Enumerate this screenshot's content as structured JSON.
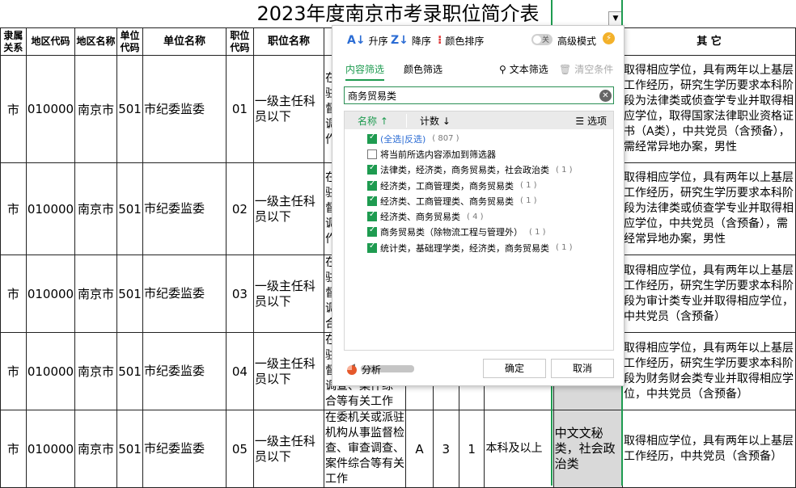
{
  "sheet": {
    "title": "2023年度南京市考录职位简介表",
    "headers": [
      "隶属关系",
      "地区代码",
      "地区名称",
      "单位代码",
      "单位名称",
      "职位代码",
      "职位名称",
      "",
      "",
      "",
      "",
      "",
      "",
      "其  它"
    ],
    "rows": [
      {
        "rel": "市",
        "area_code": "010000",
        "area": "南京市",
        "unit_code": "501",
        "unit": "市纪委监委",
        "pos_code": "01",
        "pos": "一级主任科员以下",
        "desc": "在\n驻\n督\n调\n作",
        "exam": "",
        "n1": "",
        "n2": "",
        "edu": "",
        "major": "",
        "other": "取得相应学位，具有两年以上基层工作经历，研究生学历要求本科阶段为法律类或侦查学专业并取得相应学位，取得国家法律职业资格证书（A类），中共党员（含预备），需经常异地办案，男性"
      },
      {
        "rel": "市",
        "area_code": "010000",
        "area": "南京市",
        "unit_code": "501",
        "unit": "市纪委监委",
        "pos_code": "02",
        "pos": "一级主任科员以下",
        "desc": "在\n驻\n督\n调\n作",
        "exam": "",
        "n1": "",
        "n2": "",
        "edu": "",
        "major": "",
        "other": "取得相应学位，具有两年以上基层工作经历，研究生学历要求本科阶段为法律类或侦查学专业并取得相应学位，中共党员（含预备），需经常异地办案，男性"
      },
      {
        "rel": "市",
        "area_code": "010000",
        "area": "南京市",
        "unit_code": "501",
        "unit": "市纪委监委",
        "pos_code": "03",
        "pos": "一级主任科员以下",
        "desc": "在\n驻\n督\n调\n合",
        "exam": "",
        "n1": "",
        "n2": "",
        "edu": "",
        "major": "",
        "other": "取得相应学位，具有两年以上基层工作经历，研究生学历要求本科阶段为审计类专业并取得相应学位，中共党员（含预备）"
      },
      {
        "rel": "市",
        "area_code": "010000",
        "area": "南京市",
        "unit_code": "501",
        "unit": "市纪委监委",
        "pos_code": "04",
        "pos": "一级主任科员以下",
        "desc": "在\n驻\n督\n调查、案件综\n合等有关工作",
        "exam": "",
        "n1": "",
        "n2": "",
        "edu": "",
        "major": "",
        "other": "取得相应学位，具有两年以上基层工作经历，研究生学历要求本科阶段为财务财会类专业并取得相应学位，中共党员（含预备）"
      },
      {
        "rel": "市",
        "area_code": "010000",
        "area": "南京市",
        "unit_code": "501",
        "unit": "市纪委监委",
        "pos_code": "05",
        "pos": "一级主任科员以下",
        "desc": "在委机关或派驻机构从事监督检查、审查调查、案件综合等有关工作",
        "exam": "A",
        "n1": "3",
        "n2": "1",
        "edu": "本科及以上",
        "major": "中文文秘类，社会政治类",
        "other": "取得相应学位，具有两年以上基层工作经历，中共党员（含预备）"
      }
    ]
  },
  "popup": {
    "sort_asc": "升序",
    "sort_desc": "降序",
    "color_sort": "颜色排序",
    "toggle_label": "关",
    "advanced_mode": "高级模式",
    "tab_content": "内容筛选",
    "tab_color": "颜色筛选",
    "text_filter": "文本筛选",
    "clear_conditions": "清空条件",
    "search_value": "商务贸易类",
    "col_name": "名称",
    "col_count": "计数",
    "col_options": "选项",
    "items": [
      {
        "label": "(全选|反选)",
        "count": "( 807 )",
        "checked": true
      },
      {
        "label": "将当前所选内容添加到筛选器",
        "count": "",
        "checked": false
      },
      {
        "label": "法律类，经济类，商务贸易类，社会政治类",
        "count": "( 1 )",
        "checked": true
      },
      {
        "label": "经济类，工商管理类，商务贸易类",
        "count": "( 1 )",
        "checked": true
      },
      {
        "label": "经济类、工商管理类、商务贸易类",
        "count": "( 1 )",
        "checked": true
      },
      {
        "label": "经济类、商务贸易类",
        "count": "( 4 )",
        "checked": true
      },
      {
        "label": "商务贸易类（除物流工程与管理外）",
        "count": "( 1 )",
        "checked": true
      },
      {
        "label": "统计类，基础理学类，经济类，商务贸易类",
        "count": "( 1 )",
        "checked": true
      }
    ],
    "analysis": "分析",
    "ok": "确定",
    "cancel": "取消"
  }
}
